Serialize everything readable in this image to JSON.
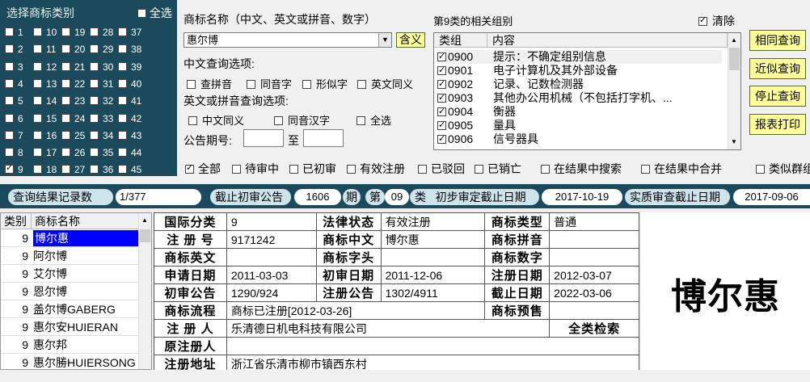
{
  "categories": {
    "header": "选择商标类别",
    "all_label": "全选",
    "all_checked": false,
    "items": [
      {
        "n": "1",
        "checked": false
      },
      {
        "n": "10",
        "checked": false
      },
      {
        "n": "19",
        "checked": false
      },
      {
        "n": "28",
        "checked": false
      },
      {
        "n": "37",
        "checked": false
      },
      {
        "n": "2",
        "checked": false
      },
      {
        "n": "11",
        "checked": false
      },
      {
        "n": "20",
        "checked": false
      },
      {
        "n": "29",
        "checked": false
      },
      {
        "n": "38",
        "checked": false
      },
      {
        "n": "3",
        "checked": false
      },
      {
        "n": "12",
        "checked": false
      },
      {
        "n": "21",
        "checked": false
      },
      {
        "n": "30",
        "checked": false
      },
      {
        "n": "39",
        "checked": false
      },
      {
        "n": "4",
        "checked": false
      },
      {
        "n": "13",
        "checked": false
      },
      {
        "n": "22",
        "checked": false
      },
      {
        "n": "31",
        "checked": false
      },
      {
        "n": "40",
        "checked": false
      },
      {
        "n": "5",
        "checked": false
      },
      {
        "n": "14",
        "checked": false
      },
      {
        "n": "23",
        "checked": false
      },
      {
        "n": "32",
        "checked": false
      },
      {
        "n": "41",
        "checked": false
      },
      {
        "n": "6",
        "checked": false
      },
      {
        "n": "15",
        "checked": false
      },
      {
        "n": "24",
        "checked": false
      },
      {
        "n": "33",
        "checked": false
      },
      {
        "n": "42",
        "checked": false
      },
      {
        "n": "7",
        "checked": false
      },
      {
        "n": "16",
        "checked": false
      },
      {
        "n": "25",
        "checked": false
      },
      {
        "n": "34",
        "checked": false
      },
      {
        "n": "43",
        "checked": false
      },
      {
        "n": "8",
        "checked": false
      },
      {
        "n": "17",
        "checked": false
      },
      {
        "n": "26",
        "checked": false
      },
      {
        "n": "35",
        "checked": false
      },
      {
        "n": "44",
        "checked": false
      },
      {
        "n": "9",
        "checked": true
      },
      {
        "n": "18",
        "checked": false
      },
      {
        "n": "27",
        "checked": false
      },
      {
        "n": "36",
        "checked": false
      },
      {
        "n": "45",
        "checked": false
      }
    ]
  },
  "query": {
    "name_label": "商标名称（中文、英文或拼音、数字）",
    "name_value": "惠尔博",
    "hanyi_button": "含义",
    "cn_options_label": "中文查询选项:",
    "cn_options": [
      {
        "label": "查拼音",
        "checked": false
      },
      {
        "label": "同音字",
        "checked": false
      },
      {
        "label": "形似字",
        "checked": false
      },
      {
        "label": "英文同义",
        "checked": false
      }
    ],
    "en_options_label": "英文或拼音查询选项:",
    "en_options": [
      {
        "label": "中文同义",
        "checked": false
      },
      {
        "label": "同音汉字",
        "checked": false
      },
      {
        "label": "全选",
        "checked": false
      }
    ],
    "period_label": "公告期号:",
    "period_to": "至",
    "period_from_value": "",
    "period_to_value": ""
  },
  "groups": {
    "title": "第9类的相关组别",
    "clear_label": "清除",
    "clear_checked": true,
    "col_group": "类组",
    "col_content": "内容",
    "rows": [
      {
        "code": "0900",
        "content": "提示：不确定组别信息",
        "checked": true
      },
      {
        "code": "0901",
        "content": "电子计算机及其外部设备",
        "checked": true
      },
      {
        "code": "0902",
        "content": "记录、记数检测器",
        "checked": true
      },
      {
        "code": "0903",
        "content": "其他办公用机械（不包括打字机、...",
        "checked": true
      },
      {
        "code": "0904",
        "content": "衡器",
        "checked": true
      },
      {
        "code": "0905",
        "content": "量具",
        "checked": true
      },
      {
        "code": "0906",
        "content": "信号器具",
        "checked": true
      }
    ]
  },
  "buttons": {
    "same": "相同查询",
    "similar": "近似查询",
    "stop": "停止查询",
    "print": "报表打印"
  },
  "filters": [
    {
      "label": "全部",
      "checked": true
    },
    {
      "label": "待审中",
      "checked": false
    },
    {
      "label": "已初审",
      "checked": false
    },
    {
      "label": "有效注册",
      "checked": false
    },
    {
      "label": "已驳回",
      "checked": false
    },
    {
      "label": "已销亡",
      "checked": false
    },
    {
      "label": "在结果中搜索",
      "checked": false
    },
    {
      "label": "在结果中合并",
      "checked": false
    },
    {
      "label": "类似群组",
      "checked": false
    }
  ],
  "status": {
    "result_count_label": "查询结果记录数",
    "result_count": "1/377",
    "cutoff_label": "截止初审公告",
    "cutoff_value": "1606",
    "cutoff_unit": "期",
    "class_prefix": "第",
    "class_value": "09",
    "class_unit": "类",
    "prelim_label": "初步审定截止日期",
    "prelim_date": "2017-10-19",
    "substantive_label": "实质审查截止日期",
    "substantive_date": "2017-09-06"
  },
  "results": {
    "col_class": "类别",
    "col_name": "商标名称",
    "rows": [
      {
        "cls": "9",
        "name": "博尔惠",
        "selected": true
      },
      {
        "cls": "9",
        "name": "阿尔博",
        "selected": false
      },
      {
        "cls": "9",
        "name": "艾尔博",
        "selected": false
      },
      {
        "cls": "9",
        "name": "恩尔博",
        "selected": false
      },
      {
        "cls": "9",
        "name": "盖尔博GABERG",
        "selected": false
      },
      {
        "cls": "9",
        "name": "惠尔安HUIERAN",
        "selected": false
      },
      {
        "cls": "9",
        "name": "惠尔邦",
        "selected": false
      },
      {
        "cls": "9",
        "name": "惠尔勝HUIERSONG",
        "selected": false
      }
    ]
  },
  "detail": {
    "intl_class_label": "国际分类",
    "intl_class": "9",
    "legal_status_label": "法律状态",
    "legal_status": "有效注册",
    "tm_type_label": "商标类型",
    "tm_type": "普通",
    "reg_no_label": "注 册 号",
    "reg_no": "9171242",
    "tm_cn_label": "商标中文",
    "tm_cn": "博尔惠",
    "tm_pinyin_label": "商标拼音",
    "tm_pinyin": "",
    "tm_en_label": "商标英文",
    "tm_en": "",
    "tm_head_label": "商标字头",
    "tm_head": "",
    "tm_digit_label": "商标数字",
    "tm_digit": "",
    "apply_date_label": "申请日期",
    "apply_date": "2011-03-03",
    "prelim_date_label": "初审日期",
    "prelim_date": "2011-12-06",
    "reg_date_label": "注册日期",
    "reg_date": "2012-03-07",
    "prelim_pub_label": "初审公告",
    "prelim_pub": "1290/924",
    "reg_pub_label": "注册公告",
    "reg_pub": "1302/4911",
    "expire_label": "截止日期",
    "expire": "2022-03-06",
    "flow_label": "商标流程",
    "flow": "商标已注册[2012-03-26]",
    "warn_label": "商标预售",
    "warn": "",
    "registrant_label": "注 册 人",
    "registrant": "乐清德日机电科技有限公司",
    "all_class_search": "全类检索",
    "orig_registrant_label": "原注册人",
    "orig_registrant": "",
    "address_label": "注册地址",
    "address": "浙江省乐清市柳市镇西东村"
  },
  "image": {
    "logo_text": "博尔惠"
  }
}
